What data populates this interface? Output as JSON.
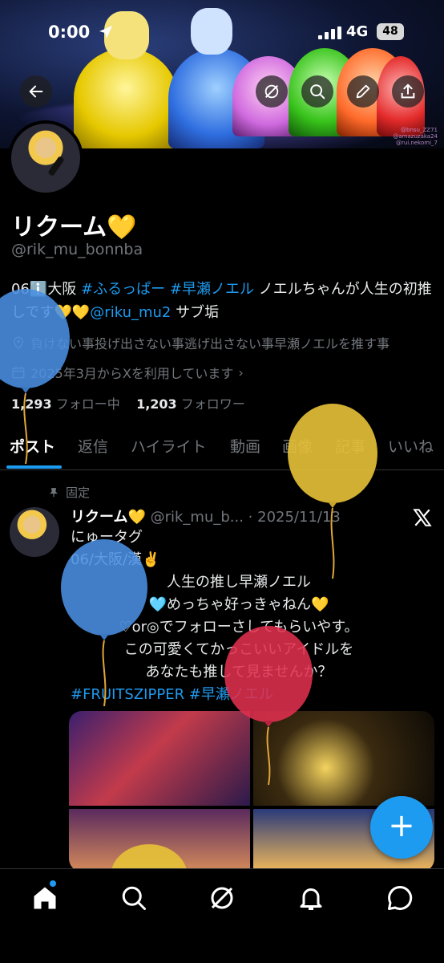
{
  "status_bar": {
    "time": "0:00",
    "network": "4G",
    "battery": "48"
  },
  "banner": {
    "credits": [
      "@bnsu_ZZ71",
      "@amazuzaka24",
      "@rui.nekomi_7"
    ]
  },
  "profile": {
    "name": "リクーム💛",
    "handle": "@rik_mu_bonnba",
    "bio_prefix": "06ℹ️大阪 ",
    "bio_tag1": "#ふるっぱー",
    "bio_tag2": "#早瀬ノエル",
    "bio_mid": " ノエルちゃんが人生の初推しです💛💛",
    "bio_mention": "@riku_mu2",
    "bio_suffix": " サブ垢",
    "location": "負けない事投げ出さない事逃げ出さない事早瀬ノエルを推す事",
    "joined": "2025年3月からXを利用しています",
    "following_count": "1,293",
    "following_label": "フォロー中",
    "followers_count": "1,203",
    "followers_label": "フォロワー"
  },
  "tabs": [
    "ポスト",
    "返信",
    "ハイライト",
    "動画",
    "画像",
    "記事",
    "いいね"
  ],
  "post": {
    "pinned_label": "固定",
    "author_name": "リクーム💛",
    "author_meta": " @rik_mu_b... · 2025/11/13",
    "lines": [
      "にゅータグ",
      "06/大阪/漢✌️",
      "人生の推し早瀬ノエル",
      "🩵めっちゃ好っきゃねん💛",
      "♡or◎でフォローさしてもらいやす。",
      "この可愛くてかっこいいアイドルを",
      "あなたも推して見ませんか？"
    ],
    "hashtags": "#FRUITSZIPPER #早瀬ノエル"
  },
  "fab": {
    "label": "+"
  },
  "colors": {
    "accent": "#1d9bf0",
    "background": "#000000",
    "muted": "#71767b"
  },
  "icons": [
    "back-arrow-icon",
    "grok-icon",
    "search-icon",
    "edit-icon",
    "share-icon",
    "pin-icon",
    "x-logo-icon",
    "location-icon",
    "calendar-icon",
    "home-icon",
    "notifications-icon",
    "messages-icon"
  ]
}
